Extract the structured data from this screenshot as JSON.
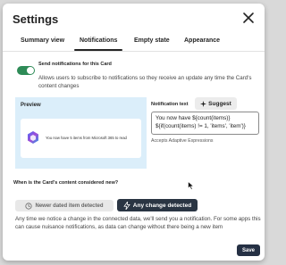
{
  "dialog": {
    "title": "Settings"
  },
  "tabs": [
    {
      "label": "Summary view"
    },
    {
      "label": "Notifications"
    },
    {
      "label": "Empty state"
    },
    {
      "label": "Appearance"
    }
  ],
  "notifications": {
    "toggle_label": "Send notifications for this Card",
    "toggle_on": true,
    "toggle_description": "Allows users to subscribe to notifications so they receive an update any time the Card's content changes",
    "preview_label": "Preview",
    "preview_text": "You now have 5 items from Microsoft 365 to read",
    "notification_text_label": "Notification text",
    "suggest_label": "Suggest",
    "notification_text_value": "You now have ${count(items)} ${if(count(items) != 1, 'items', 'item')}",
    "adaptive_expressions_label": "Accepts Adaptive Expressions",
    "when_label": "When is the Card's content considered new?",
    "newer_button_label": "Newer dated item detected",
    "any_change_button_label": "Any change detected",
    "info_text": "Any time we notice a change in the connected data, we'll send you a notification. For some apps this can cause nuisance notifications, as data can change without there being a new item",
    "save_label": "Save"
  },
  "colors": {
    "accent_dark": "#2a3543",
    "toggle_on": "#2e8b57",
    "preview_bg": "#dbeefa"
  }
}
